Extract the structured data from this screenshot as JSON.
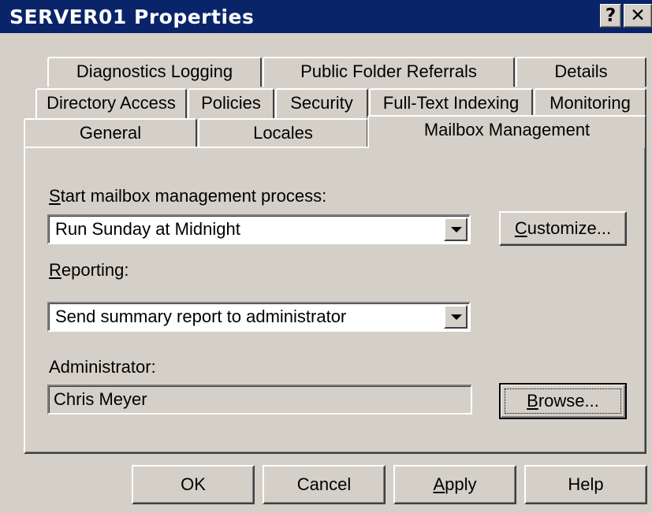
{
  "window": {
    "title": "SERVER01 Properties",
    "help_button": "?",
    "close_button": "✕"
  },
  "tabs": {
    "row1": [
      "Diagnostics Logging",
      "Public Folder Referrals",
      "Details"
    ],
    "row2": [
      "Directory Access",
      "Policies",
      "Security",
      "Full-Text Indexing",
      "Monitoring"
    ],
    "row3": [
      "General",
      "Locales",
      "Mailbox Management"
    ],
    "selected": "Mailbox Management"
  },
  "mailbox": {
    "start_label_key": "S",
    "start_label_rest": "tart mailbox management process:",
    "start_value": "Run Sunday at Midnight",
    "customize_key": "C",
    "customize_rest": "ustomize...",
    "reporting_key": "R",
    "reporting_rest": "eporting:",
    "reporting_value": "Send summary report to administrator",
    "admin_label": "Administrator:",
    "admin_value": "Chris Meyer",
    "browse_key": "B",
    "browse_rest": "rowse..."
  },
  "footer": {
    "ok": "OK",
    "cancel": "Cancel",
    "apply_key": "A",
    "apply_rest": "pply",
    "help": "Help"
  }
}
